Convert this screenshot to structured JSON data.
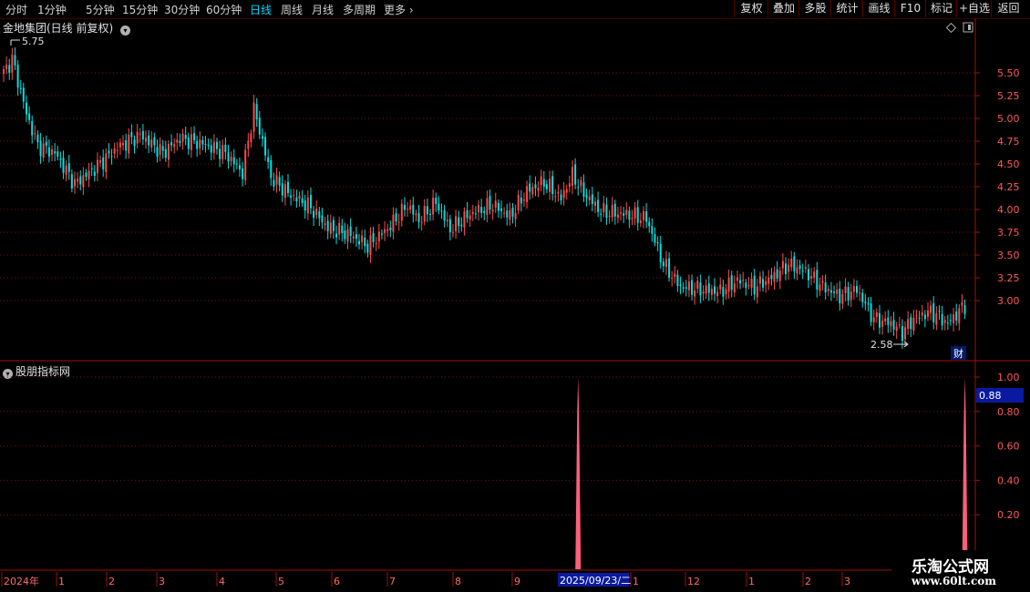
{
  "toolbar": {
    "periods": [
      "分时",
      "1分钟",
      "5分钟",
      "15分钟",
      "30分钟",
      "60分钟",
      "日线",
      "周线",
      "月线",
      "多周期",
      "更多"
    ],
    "active_period": "日线",
    "more_arrow": "›",
    "buttons": [
      "复权",
      "叠加",
      "多股",
      "统计",
      "画线",
      "F10",
      "标记",
      "+自选",
      "返回"
    ]
  },
  "main_chart": {
    "title": "金地集团(日线 前复权)",
    "high_label": "5.75",
    "low_label": "2.58",
    "badge": "财",
    "price_ticks": [
      "5.50",
      "5.25",
      "5.00",
      "4.75",
      "4.50",
      "4.25",
      "4.00",
      "3.75",
      "3.50",
      "3.25",
      "3.00"
    ],
    "colors": {
      "up": "#ff4a4a",
      "down": "#00e0e0",
      "grid": "#7a1010",
      "axis_text": "#ff5a5a"
    }
  },
  "indicator": {
    "title": "股朋指标网",
    "ticks": [
      "1.00",
      "0.80",
      "0.60",
      "0.40",
      "0.20"
    ],
    "current_value": "0.88",
    "bar_color": "#ff5f7a"
  },
  "date_axis": {
    "labels": [
      "2024年",
      "1",
      "2",
      "3",
      "4",
      "5",
      "6",
      "7",
      "8",
      "9",
      "1",
      "12",
      "1",
      "2",
      "3"
    ],
    "highlight": "2025/09/23/二"
  },
  "watermark": {
    "title": "乐淘公式网",
    "url": "www.60lt.com"
  },
  "chart_data": {
    "type": "candlestick",
    "ylim": [
      2.4,
      5.9
    ],
    "approx_close_path": [
      [
        0,
        5.5
      ],
      [
        3,
        5.65
      ],
      [
        6,
        5.3
      ],
      [
        8,
        5.05
      ],
      [
        12,
        4.7
      ],
      [
        18,
        4.62
      ],
      [
        25,
        4.28
      ],
      [
        32,
        4.45
      ],
      [
        40,
        4.68
      ],
      [
        48,
        4.82
      ],
      [
        56,
        4.62
      ],
      [
        62,
        4.78
      ],
      [
        70,
        4.72
      ],
      [
        78,
        4.62
      ],
      [
        84,
        4.4
      ],
      [
        88,
        5.1
      ],
      [
        91,
        4.75
      ],
      [
        94,
        4.35
      ],
      [
        100,
        4.18
      ],
      [
        108,
        4.02
      ],
      [
        114,
        3.8
      ],
      [
        122,
        3.72
      ],
      [
        128,
        3.6
      ],
      [
        136,
        3.82
      ],
      [
        142,
        4.05
      ],
      [
        146,
        3.88
      ],
      [
        152,
        4.08
      ],
      [
        157,
        3.78
      ],
      [
        164,
        3.95
      ],
      [
        172,
        4.05
      ],
      [
        178,
        3.92
      ],
      [
        184,
        4.2
      ],
      [
        190,
        4.3
      ],
      [
        196,
        4.12
      ],
      [
        200,
        4.38
      ],
      [
        204,
        4.18
      ],
      [
        210,
        3.98
      ],
      [
        218,
        3.95
      ],
      [
        226,
        3.9
      ],
      [
        232,
        3.4
      ],
      [
        238,
        3.15
      ],
      [
        245,
        3.12
      ],
      [
        252,
        3.1
      ],
      [
        258,
        3.22
      ],
      [
        264,
        3.15
      ],
      [
        270,
        3.25
      ],
      [
        276,
        3.4
      ],
      [
        282,
        3.32
      ],
      [
        288,
        3.15
      ],
      [
        294,
        3.05
      ],
      [
        300,
        3.12
      ],
      [
        306,
        2.8
      ],
      [
        312,
        2.75
      ],
      [
        316,
        2.65
      ],
      [
        320,
        2.8
      ],
      [
        326,
        2.88
      ],
      [
        332,
        2.75
      ],
      [
        338,
        2.95
      ]
    ],
    "indicator_bars": [
      {
        "x": 202,
        "value": 1.0
      },
      {
        "x": 338,
        "value": 1.0
      }
    ]
  }
}
